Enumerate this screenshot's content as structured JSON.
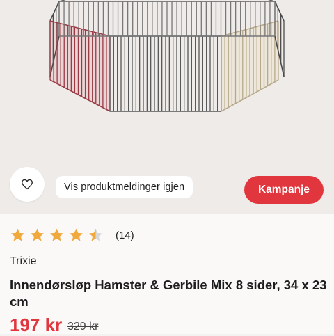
{
  "product": {
    "favorite_icon": "heart-icon",
    "notifications_link": "Vis produktmeldinger igjen",
    "campaign_label": "Kampanje",
    "rating": {
      "value": 4.5,
      "max": 5,
      "count_label": "(14)"
    },
    "brand": "Trixie",
    "title": "Innendørsløp Hamster & Gerbile Mix 8 sider, 34 x 23 cm",
    "price": "197 kr",
    "old_price": "329 kr"
  },
  "colors": {
    "accent": "#e1363e",
    "star": "#f2a93b",
    "star_empty": "#d8d8d8"
  }
}
